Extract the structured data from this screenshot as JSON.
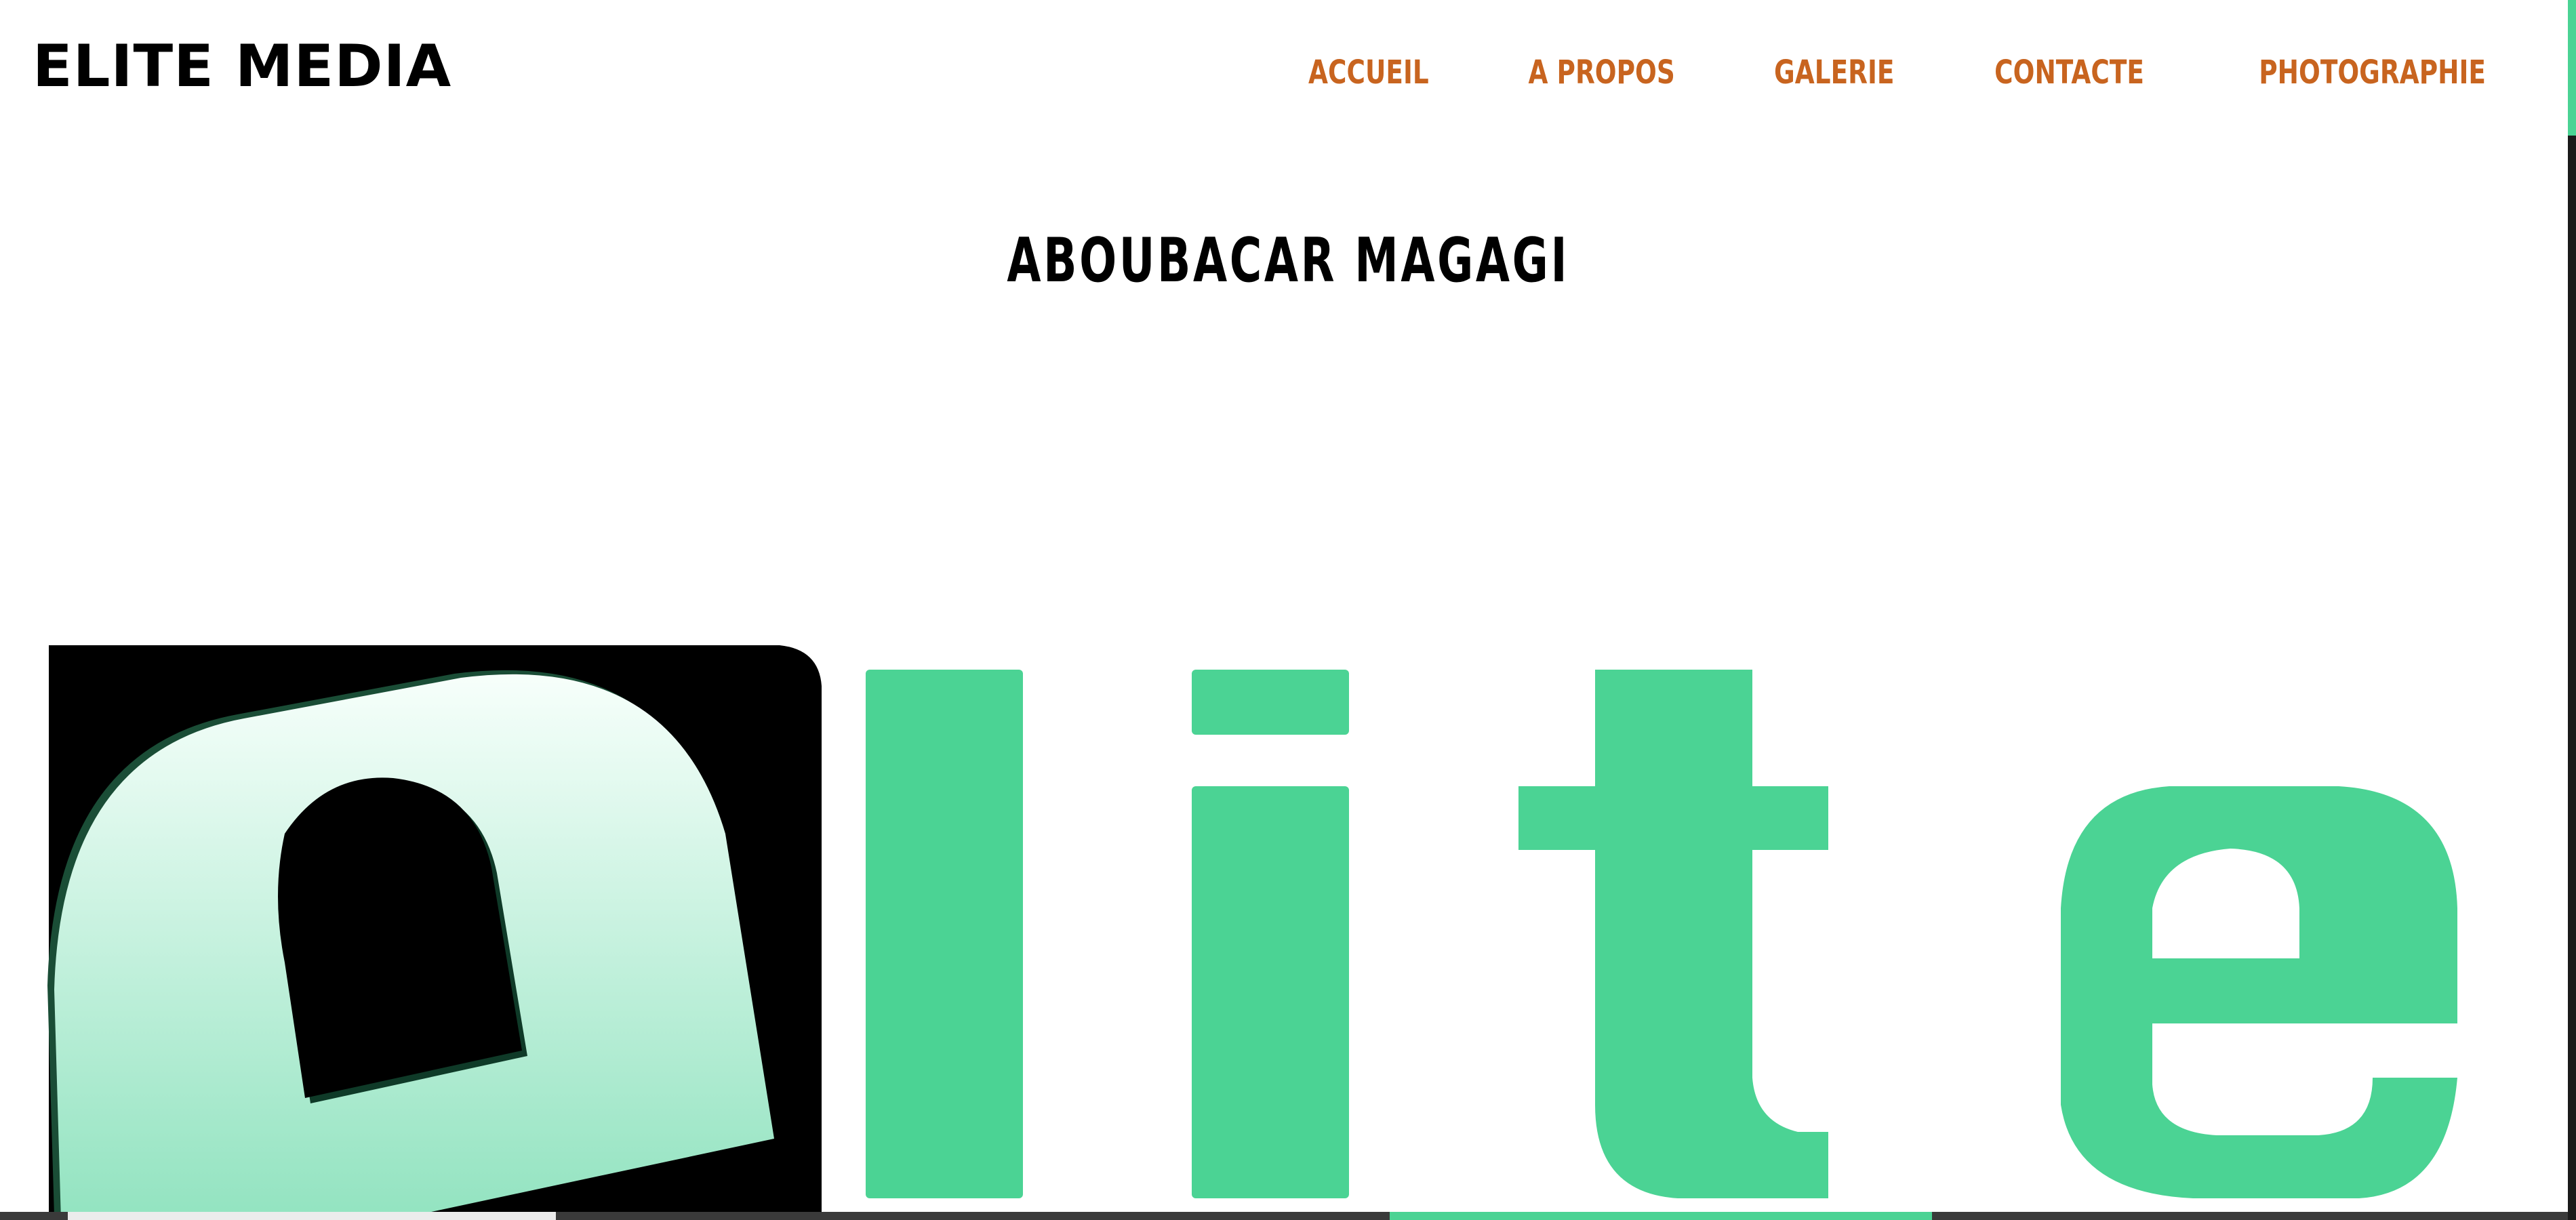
{
  "header": {
    "brand": "ELITE MEDIA",
    "nav": [
      "ACCUEIL",
      "A PROPOS",
      "GALERIE",
      "CONTACTE",
      "PHOTOGRAPHIE"
    ]
  },
  "main": {
    "title": "ABOUBACAR MAGAGI"
  },
  "logo": {
    "letters": "lite",
    "accent_color": "#4bd394",
    "nav_color": "#c8641f"
  }
}
